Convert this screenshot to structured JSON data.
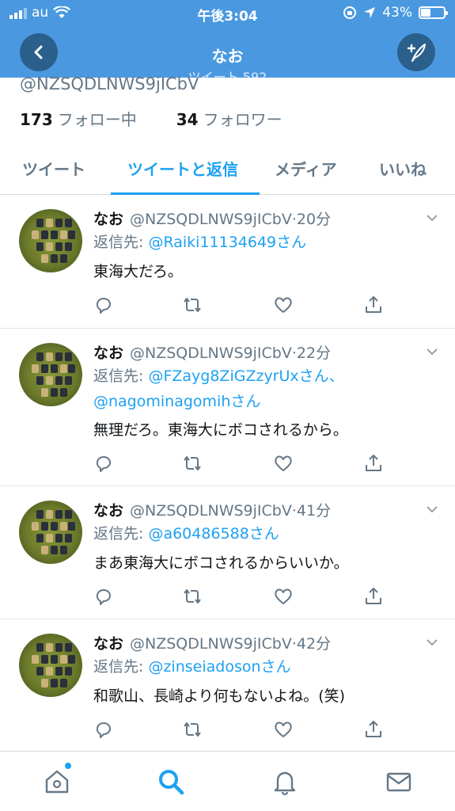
{
  "status_bar": {
    "carrier": "au",
    "time": "午後3:04",
    "battery_percent": "43%",
    "battery_level": 0.43
  },
  "header": {
    "title": "なお",
    "subtitle": "ツイート 592",
    "back_icon": "chevron-left-icon",
    "compose_icon": "compose-tweet-icon",
    "color": "#4a99e0"
  },
  "profile": {
    "handle": "@NZSQDLNWS9jICbV",
    "following_count": "173",
    "following_label": "フォロー中",
    "followers_count": "34",
    "followers_label": "フォロワー"
  },
  "tabs": [
    {
      "label": "ツイート",
      "active": false
    },
    {
      "label": "ツイートと返信",
      "active": true
    },
    {
      "label": "メディア",
      "active": false
    },
    {
      "label": "いいね",
      "active": false
    }
  ],
  "tweets": [
    {
      "name": "なお",
      "handle": "@NZSQDLNWS9jICbV",
      "time": "20分",
      "reply_prefix": "返信先: ",
      "reply_to": "@Raiki11134649さん",
      "reply_to_2": "",
      "text": "東海大だろ。"
    },
    {
      "name": "なお",
      "handle": "@NZSQDLNWS9jICbV",
      "time": "22分",
      "reply_prefix": "返信先: ",
      "reply_to": "@FZayg8ZiGZzyrUxさん、",
      "reply_to_2": "@nagominagomihさん",
      "text": "無理だろ。東海大にボコされるから。"
    },
    {
      "name": "なお",
      "handle": "@NZSQDLNWS9jICbV",
      "time": "41分",
      "reply_prefix": "返信先: ",
      "reply_to": "@a60486588さん",
      "reply_to_2": "",
      "text": "まあ東海大にボコされるからいいか。"
    },
    {
      "name": "なお",
      "handle": "@NZSQDLNWS9jICbV",
      "time": "42分",
      "reply_prefix": "返信先: ",
      "reply_to": "@zinseiadosonさん",
      "reply_to_2": "",
      "text": "和歌山、長崎より何もないよね。(笑)"
    }
  ],
  "tweet_actions": [
    "reply-icon",
    "retweet-icon",
    "like-icon",
    "share-icon"
  ],
  "bottom_nav": [
    "home-icon",
    "search-icon",
    "notifications-icon",
    "messages-icon"
  ],
  "colors": {
    "accent": "#1da1f2",
    "muted_text": "#657786"
  }
}
